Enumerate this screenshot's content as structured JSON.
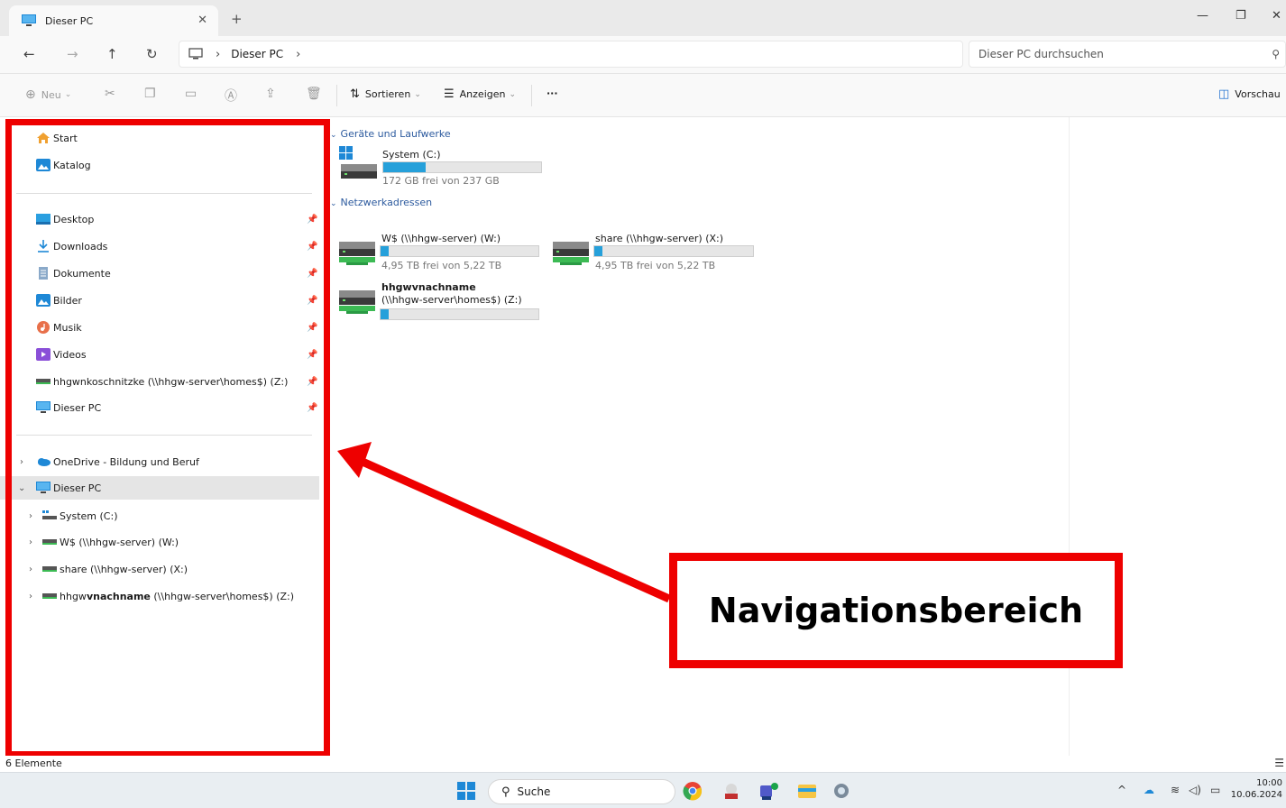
{
  "window": {
    "tab_title": "Dieser PC",
    "address_segment": "Dieser PC",
    "search_placeholder": "Dieser PC durchsuchen"
  },
  "toolbar": {
    "new_label": "Neu",
    "sort_label": "Sortieren",
    "view_label": "Anzeigen",
    "more_label": "···",
    "preview_label": "Vorschau"
  },
  "sidebar": {
    "top": [
      {
        "label": "Start",
        "icon": "home-icon"
      },
      {
        "label": "Katalog",
        "icon": "gallery-icon"
      }
    ],
    "pinned": [
      {
        "label": "Desktop",
        "icon": "desktop-icon"
      },
      {
        "label": "Downloads",
        "icon": "download-icon"
      },
      {
        "label": "Dokumente",
        "icon": "documents-icon"
      },
      {
        "label": "Bilder",
        "icon": "pictures-icon"
      },
      {
        "label": "Musik",
        "icon": "music-icon"
      },
      {
        "label": "Videos",
        "icon": "videos-icon"
      },
      {
        "label": "hhgwnkoschnitzke (\\\\hhgw-server\\homes$) (Z:)",
        "icon": "network-drive-icon"
      },
      {
        "label": "Dieser PC",
        "icon": "pc-icon"
      }
    ],
    "tree": [
      {
        "label": "OneDrive - Bildung und Beruf",
        "icon": "onedrive-icon"
      },
      {
        "label": "Dieser PC",
        "icon": "pc-icon"
      },
      {
        "label": "System (C:)",
        "icon": "system-drive-icon"
      },
      {
        "label": "W$ (\\\\hhgw-server) (W:)",
        "icon": "network-drive-icon"
      },
      {
        "label": "share (\\\\hhgw-server) (X:)",
        "icon": "network-drive-icon"
      },
      {
        "label_prefix": "hhgw",
        "label_bold": "vnachname",
        "label_suffix": " (\\\\hhgw-server\\homes$) (Z:)",
        "icon": "network-drive-icon"
      }
    ]
  },
  "content": {
    "group_devices": "Geräte und Laufwerke",
    "group_network": "Netzwerkadressen",
    "drives": [
      {
        "name": "System (C:)",
        "free": "172 GB frei von 237 GB",
        "used_fraction": 0.27
      },
      {
        "name": "W$ (\\\\hhgw-server) (W:)",
        "free": "4,95 TB frei von 5,22 TB",
        "used_fraction": 0.05
      },
      {
        "name": "share (\\\\hhgw-server) (X:)",
        "free": "4,95 TB frei von 5,22 TB",
        "used_fraction": 0.05
      },
      {
        "name_line1": "hhgwvnachname",
        "name_line2": "(\\\\hhgw-server\\homes$) (Z:)",
        "used_fraction": 0.05
      }
    ]
  },
  "callout": {
    "text": "Navigationsbereich"
  },
  "statusbar": {
    "count": "6 Elemente"
  },
  "taskbar": {
    "search_label": "Suche",
    "time": "10:00",
    "date": "10.06.2024"
  },
  "colors": {
    "accent": "#26a0da",
    "highlight": "#ee0000",
    "group_heading": "#2c5a9e"
  }
}
